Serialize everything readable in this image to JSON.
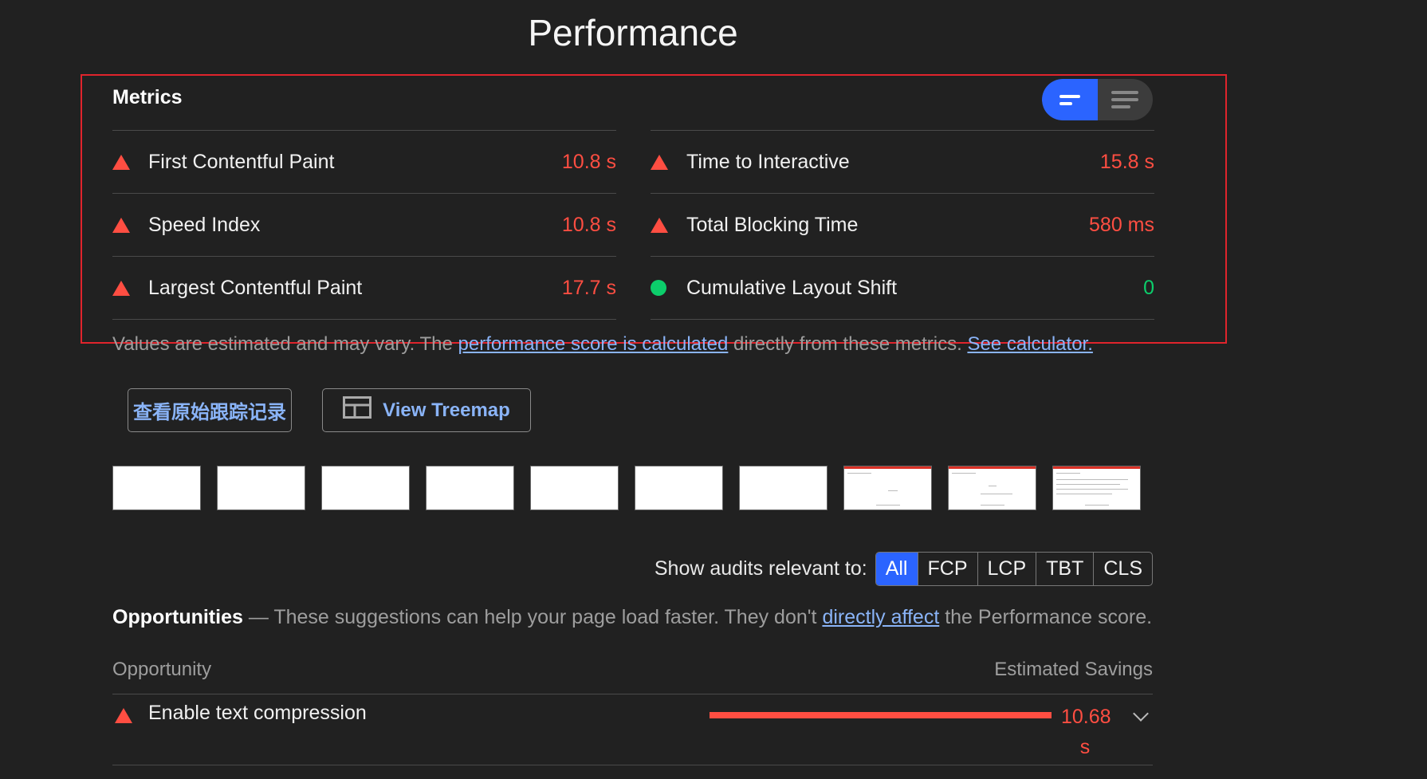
{
  "page_title": "Performance",
  "metrics": {
    "heading": "Metrics",
    "left": [
      {
        "label": "First Contentful Paint",
        "value": "10.8 s",
        "status": "fail"
      },
      {
        "label": "Speed Index",
        "value": "10.8 s",
        "status": "fail"
      },
      {
        "label": "Largest Contentful Paint",
        "value": "17.7 s",
        "status": "fail"
      }
    ],
    "right": [
      {
        "label": "Time to Interactive",
        "value": "15.8 s",
        "status": "fail"
      },
      {
        "label": "Total Blocking Time",
        "value": "580 ms",
        "status": "fail"
      },
      {
        "label": "Cumulative Layout Shift",
        "value": "0",
        "status": "pass"
      }
    ]
  },
  "note": {
    "prefix": "Values are estimated and may vary. The ",
    "link1": "performance score is calculated",
    "middle": " directly from these metrics. ",
    "link2": "See calculator."
  },
  "buttons": {
    "trace": "查看原始跟踪记录",
    "treemap": "View Treemap"
  },
  "audit_filter": {
    "label": "Show audits relevant to:",
    "options": [
      "All",
      "FCP",
      "LCP",
      "TBT",
      "CLS"
    ],
    "selected": "All"
  },
  "opportunities": {
    "title": "Opportunities",
    "dash": " — These suggestions can help your page load faster. They don't ",
    "link": "directly affect",
    "suffix": " the Performance score.",
    "col_left": "Opportunity",
    "col_right": "Estimated Savings",
    "items": [
      {
        "label": "Enable text compression",
        "value": "10.68",
        "unit": "s"
      }
    ]
  },
  "colors": {
    "fail": "#ff4e42",
    "pass": "#0cce6b",
    "accent": "#2b64ff",
    "link": "#8ab4f8"
  }
}
